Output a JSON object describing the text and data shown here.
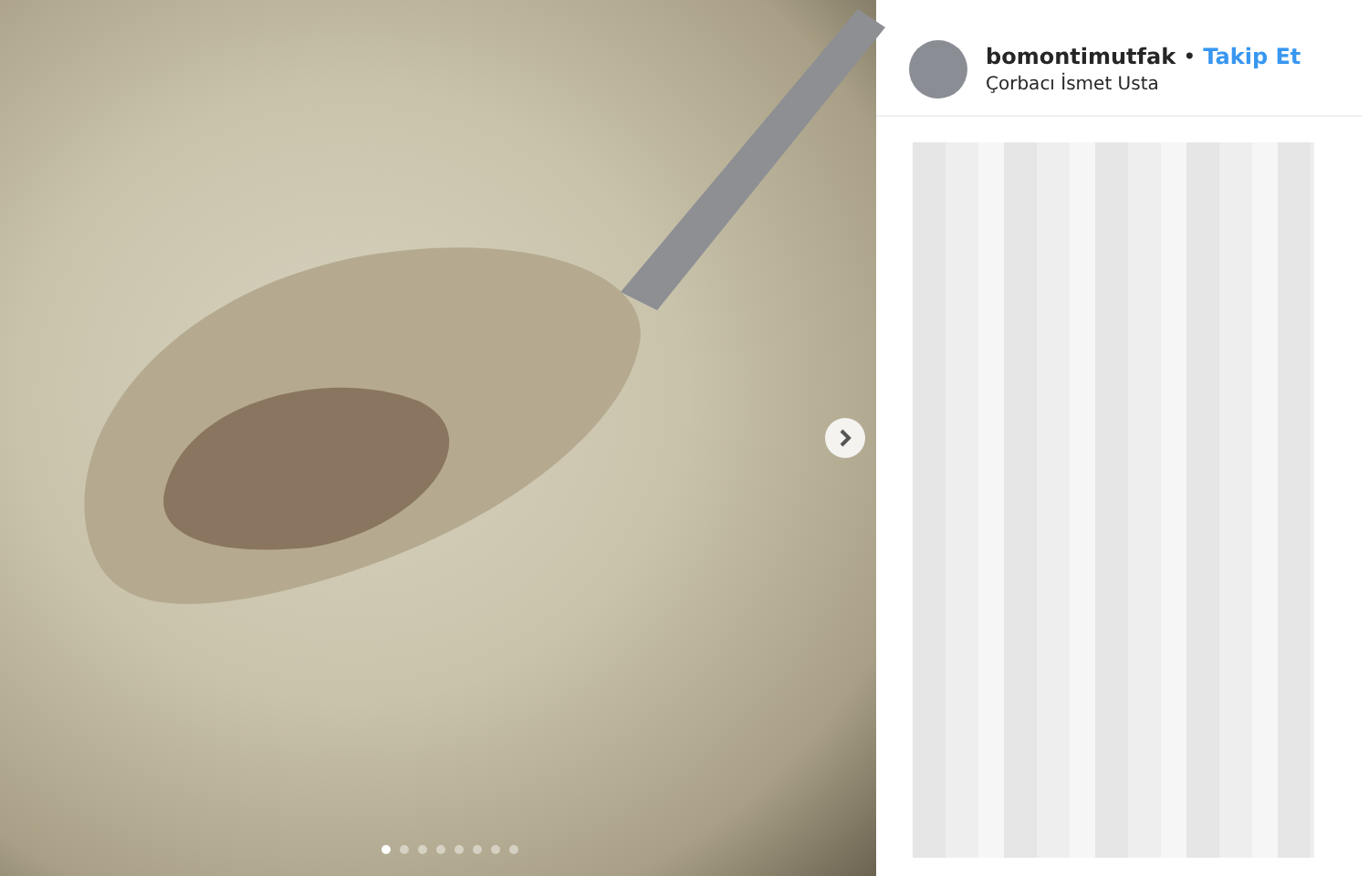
{
  "post": {
    "username": "bomontimutfak",
    "separator": "•",
    "follow": "Takip Et",
    "location": "Çorbacı İsmet Usta"
  },
  "carousel": {
    "dots": [
      {
        "selected": true
      },
      {
        "selected": false
      },
      {
        "selected": false
      },
      {
        "selected": false
      },
      {
        "selected": false
      },
      {
        "selected": false
      },
      {
        "selected": false
      },
      {
        "selected": false
      }
    ]
  }
}
